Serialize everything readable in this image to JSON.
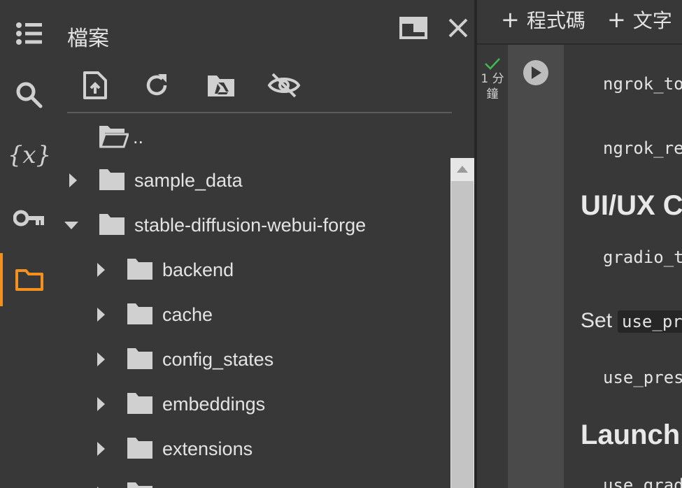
{
  "rail": {
    "items": [
      {
        "name": "table-of-contents",
        "icon": "list-icon"
      },
      {
        "name": "search",
        "icon": "search-icon"
      },
      {
        "name": "variables",
        "icon": "variables-icon",
        "glyph": "{x}"
      },
      {
        "name": "secrets",
        "icon": "key-icon"
      },
      {
        "name": "files",
        "icon": "folder-icon",
        "active": true
      }
    ],
    "accent_color": "#f4901e"
  },
  "files_panel": {
    "title": "檔案",
    "actions": [
      "new-window-icon",
      "close-icon"
    ],
    "toolbar": [
      "upload-file-icon",
      "refresh-icon",
      "mount-drive-icon",
      "hide-files-icon"
    ],
    "tree": [
      {
        "label": "..",
        "depth": 0,
        "expanded": null,
        "kind": "open-folder"
      },
      {
        "label": "sample_data",
        "depth": 0,
        "expanded": false
      },
      {
        "label": "stable-diffusion-webui-forge",
        "depth": 0,
        "expanded": true
      },
      {
        "label": "backend",
        "depth": 1,
        "expanded": false
      },
      {
        "label": "cache",
        "depth": 1,
        "expanded": false
      },
      {
        "label": "config_states",
        "depth": 1,
        "expanded": false
      },
      {
        "label": "embeddings",
        "depth": 1,
        "expanded": false
      },
      {
        "label": "extensions",
        "depth": 1,
        "expanded": false
      }
    ]
  },
  "notebook": {
    "toolbar": {
      "add_code": "程式碼",
      "add_text": "文字",
      "plus": "+"
    },
    "cell": {
      "exec_time_line1": "1 分",
      "exec_time_line2": "鐘",
      "status_color": "#3fb950"
    },
    "lines": {
      "code1": "ngrok_to",
      "code2": "ngrok_re",
      "heading1": "UI/UX Co",
      "code3": "gradio_t",
      "para_prefix": "Set",
      "para_code": "use_pr",
      "code4": "use_pres",
      "heading2": "Launch A",
      "code5": "use_grad"
    }
  }
}
